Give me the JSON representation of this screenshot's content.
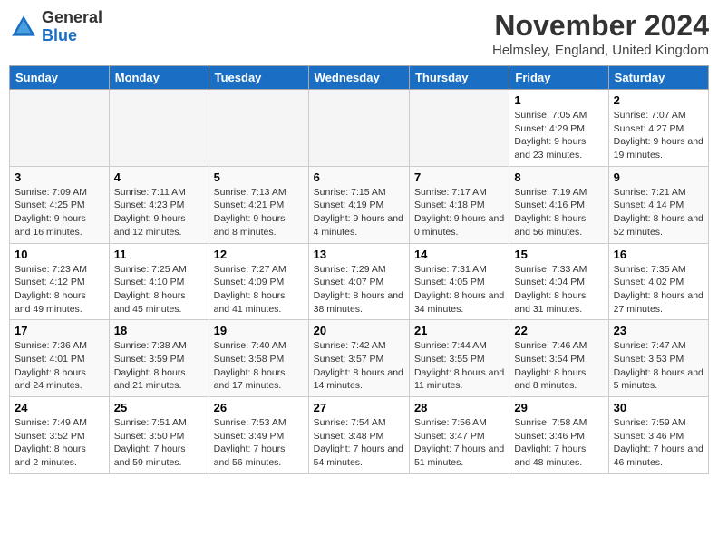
{
  "logo": {
    "general": "General",
    "blue": "Blue"
  },
  "title": "November 2024",
  "location": "Helmsley, England, United Kingdom",
  "days_of_week": [
    "Sunday",
    "Monday",
    "Tuesday",
    "Wednesday",
    "Thursday",
    "Friday",
    "Saturday"
  ],
  "weeks": [
    [
      {
        "day": "",
        "detail": ""
      },
      {
        "day": "",
        "detail": ""
      },
      {
        "day": "",
        "detail": ""
      },
      {
        "day": "",
        "detail": ""
      },
      {
        "day": "",
        "detail": ""
      },
      {
        "day": "1",
        "detail": "Sunrise: 7:05 AM\nSunset: 4:29 PM\nDaylight: 9 hours and 23 minutes."
      },
      {
        "day": "2",
        "detail": "Sunrise: 7:07 AM\nSunset: 4:27 PM\nDaylight: 9 hours and 19 minutes."
      }
    ],
    [
      {
        "day": "3",
        "detail": "Sunrise: 7:09 AM\nSunset: 4:25 PM\nDaylight: 9 hours and 16 minutes."
      },
      {
        "day": "4",
        "detail": "Sunrise: 7:11 AM\nSunset: 4:23 PM\nDaylight: 9 hours and 12 minutes."
      },
      {
        "day": "5",
        "detail": "Sunrise: 7:13 AM\nSunset: 4:21 PM\nDaylight: 9 hours and 8 minutes."
      },
      {
        "day": "6",
        "detail": "Sunrise: 7:15 AM\nSunset: 4:19 PM\nDaylight: 9 hours and 4 minutes."
      },
      {
        "day": "7",
        "detail": "Sunrise: 7:17 AM\nSunset: 4:18 PM\nDaylight: 9 hours and 0 minutes."
      },
      {
        "day": "8",
        "detail": "Sunrise: 7:19 AM\nSunset: 4:16 PM\nDaylight: 8 hours and 56 minutes."
      },
      {
        "day": "9",
        "detail": "Sunrise: 7:21 AM\nSunset: 4:14 PM\nDaylight: 8 hours and 52 minutes."
      }
    ],
    [
      {
        "day": "10",
        "detail": "Sunrise: 7:23 AM\nSunset: 4:12 PM\nDaylight: 8 hours and 49 minutes."
      },
      {
        "day": "11",
        "detail": "Sunrise: 7:25 AM\nSunset: 4:10 PM\nDaylight: 8 hours and 45 minutes."
      },
      {
        "day": "12",
        "detail": "Sunrise: 7:27 AM\nSunset: 4:09 PM\nDaylight: 8 hours and 41 minutes."
      },
      {
        "day": "13",
        "detail": "Sunrise: 7:29 AM\nSunset: 4:07 PM\nDaylight: 8 hours and 38 minutes."
      },
      {
        "day": "14",
        "detail": "Sunrise: 7:31 AM\nSunset: 4:05 PM\nDaylight: 8 hours and 34 minutes."
      },
      {
        "day": "15",
        "detail": "Sunrise: 7:33 AM\nSunset: 4:04 PM\nDaylight: 8 hours and 31 minutes."
      },
      {
        "day": "16",
        "detail": "Sunrise: 7:35 AM\nSunset: 4:02 PM\nDaylight: 8 hours and 27 minutes."
      }
    ],
    [
      {
        "day": "17",
        "detail": "Sunrise: 7:36 AM\nSunset: 4:01 PM\nDaylight: 8 hours and 24 minutes."
      },
      {
        "day": "18",
        "detail": "Sunrise: 7:38 AM\nSunset: 3:59 PM\nDaylight: 8 hours and 21 minutes."
      },
      {
        "day": "19",
        "detail": "Sunrise: 7:40 AM\nSunset: 3:58 PM\nDaylight: 8 hours and 17 minutes."
      },
      {
        "day": "20",
        "detail": "Sunrise: 7:42 AM\nSunset: 3:57 PM\nDaylight: 8 hours and 14 minutes."
      },
      {
        "day": "21",
        "detail": "Sunrise: 7:44 AM\nSunset: 3:55 PM\nDaylight: 8 hours and 11 minutes."
      },
      {
        "day": "22",
        "detail": "Sunrise: 7:46 AM\nSunset: 3:54 PM\nDaylight: 8 hours and 8 minutes."
      },
      {
        "day": "23",
        "detail": "Sunrise: 7:47 AM\nSunset: 3:53 PM\nDaylight: 8 hours and 5 minutes."
      }
    ],
    [
      {
        "day": "24",
        "detail": "Sunrise: 7:49 AM\nSunset: 3:52 PM\nDaylight: 8 hours and 2 minutes."
      },
      {
        "day": "25",
        "detail": "Sunrise: 7:51 AM\nSunset: 3:50 PM\nDaylight: 7 hours and 59 minutes."
      },
      {
        "day": "26",
        "detail": "Sunrise: 7:53 AM\nSunset: 3:49 PM\nDaylight: 7 hours and 56 minutes."
      },
      {
        "day": "27",
        "detail": "Sunrise: 7:54 AM\nSunset: 3:48 PM\nDaylight: 7 hours and 54 minutes."
      },
      {
        "day": "28",
        "detail": "Sunrise: 7:56 AM\nSunset: 3:47 PM\nDaylight: 7 hours and 51 minutes."
      },
      {
        "day": "29",
        "detail": "Sunrise: 7:58 AM\nSunset: 3:46 PM\nDaylight: 7 hours and 48 minutes."
      },
      {
        "day": "30",
        "detail": "Sunrise: 7:59 AM\nSunset: 3:46 PM\nDaylight: 7 hours and 46 minutes."
      }
    ]
  ]
}
